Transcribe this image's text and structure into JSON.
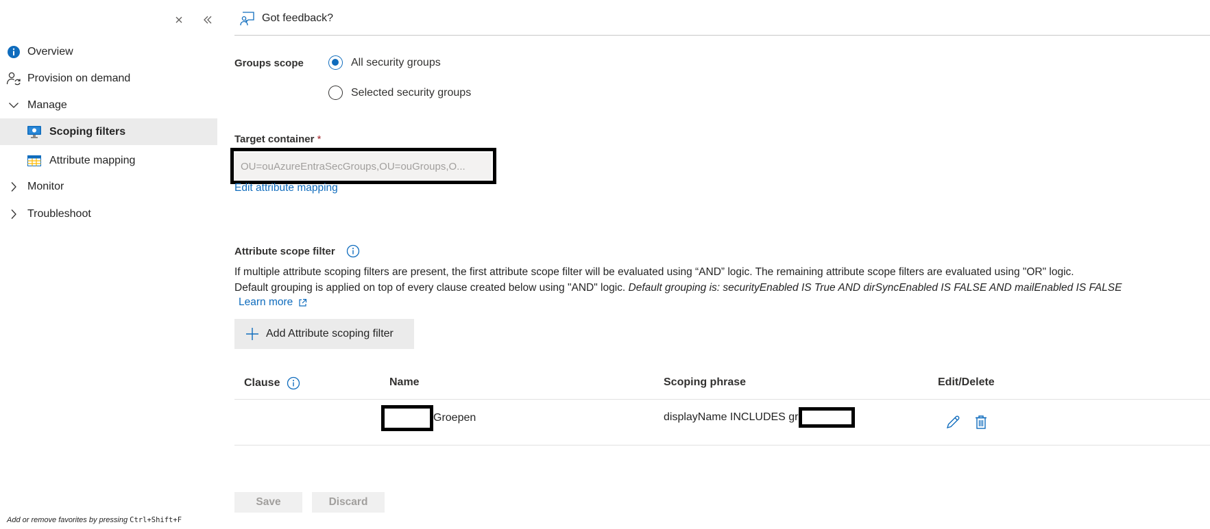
{
  "sidebar": {
    "close_icon": "close-icon",
    "collapse_icon": "double-chevron-left-icon",
    "items": [
      {
        "label": "Overview",
        "icon": "info-icon"
      },
      {
        "label": "Provision on demand",
        "icon": "person-sync-icon"
      },
      {
        "label": "Manage",
        "icon": "chevron-down-icon"
      },
      {
        "label": "Scoping filters",
        "icon": "monitor-filter-icon",
        "active": true
      },
      {
        "label": "Attribute mapping",
        "icon": "table-grid-icon"
      },
      {
        "label": "Monitor",
        "icon": "chevron-right-icon"
      },
      {
        "label": "Troubleshoot",
        "icon": "chevron-right-icon"
      }
    ],
    "footer_text": "Add or remove favorites by pressing",
    "footer_shortcut": "Ctrl+Shift+F"
  },
  "toolbar": {
    "feedback_label": "Got feedback?"
  },
  "groups_scope": {
    "label": "Groups scope",
    "options": [
      {
        "label": "All security groups",
        "checked": true
      },
      {
        "label": "Selected security groups",
        "checked": false
      }
    ]
  },
  "target_container": {
    "label": "Target container",
    "required_mark": "*",
    "value": "OU=ouAzureEntraSecGroups,OU=ouGroups,O...",
    "edit_link": "Edit attribute mapping"
  },
  "attribute_scope": {
    "title": "Attribute scope filter",
    "description_line1": "If multiple attribute scoping filters are present, the first attribute scope filter will be evaluated using “AND” logic. The remaining attribute scope filters are evaluated using \"OR\" logic.",
    "description_line2": "Default grouping is applied on top of every clause created below using \"AND\" logic.",
    "description_italic": "Default grouping is: securityEnabled IS True AND dirSyncEnabled IS FALSE AND mailEnabled IS FALSE",
    "learn_more": "Learn more",
    "add_button": "Add Attribute scoping filter"
  },
  "filters_table": {
    "columns": [
      "Clause",
      "Name",
      "Scoping phrase",
      "Edit/Delete"
    ],
    "rows": [
      {
        "clause": "",
        "name": "Groepen",
        "scoping_phrase": "displayName INCLUDES gr"
      }
    ]
  },
  "footer": {
    "save_label": "Save",
    "discard_label": "Discard"
  },
  "colors": {
    "accent": "#0f6cbd",
    "selected_bg": "#ebebeb",
    "disabled_text": "#a19f9d"
  }
}
